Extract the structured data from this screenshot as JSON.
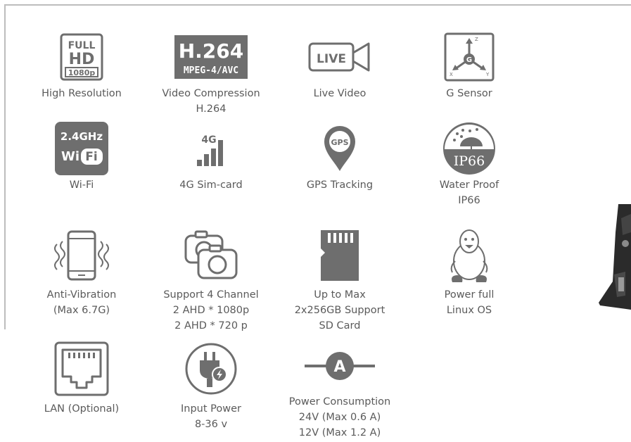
{
  "features": [
    {
      "icon": "full-hd-icon",
      "badge": [
        "FULL",
        "HD",
        "1080p"
      ],
      "lines": [
        "High Resolution"
      ]
    },
    {
      "icon": "h264-icon",
      "badge": [
        "H.264",
        "MPEG-4/AVC"
      ],
      "lines": [
        "Video Compression",
        "H.264"
      ]
    },
    {
      "icon": "live-video-icon",
      "badge": [
        "LIVE"
      ],
      "lines": [
        "Live Video"
      ]
    },
    {
      "icon": "g-sensor-icon",
      "badge": [
        "G",
        "Z",
        "X",
        "Y"
      ],
      "lines": [
        "G Sensor"
      ]
    },
    {
      "icon": "wifi-icon",
      "badge": [
        "2.4GHz",
        "Wi",
        "Fi"
      ],
      "lines": [
        "Wi-Fi"
      ]
    },
    {
      "icon": "4g-signal-icon",
      "badge": [
        "4G"
      ],
      "lines": [
        "4G Sim-card"
      ]
    },
    {
      "icon": "gps-pin-icon",
      "badge": [
        "GPS"
      ],
      "lines": [
        "GPS Tracking"
      ]
    },
    {
      "icon": "ip66-umbrella-icon",
      "badge": [
        "IP66"
      ],
      "lines": [
        "Water Proof",
        "IP66"
      ]
    },
    {
      "icon": "vibrating-phone-icon",
      "badge": [],
      "lines": [
        "Anti-Vibration",
        "(Max 6.7G)"
      ]
    },
    {
      "icon": "cameras-icon",
      "badge": [],
      "lines": [
        "Support 4 Channel",
        "2 AHD * 1080p",
        "2 AHD * 720 p"
      ]
    },
    {
      "icon": "sd-card-icon",
      "badge": [],
      "lines": [
        "Up to Max",
        "2x256GB Support",
        "SD Card"
      ]
    },
    {
      "icon": "linux-penguin-icon",
      "badge": [],
      "lines": [
        "Power full",
        "Linux OS"
      ]
    },
    {
      "icon": "lan-port-icon",
      "badge": [],
      "lines": [
        "LAN (Optional)"
      ]
    },
    {
      "icon": "power-plug-icon",
      "badge": [],
      "lines": [
        "Input Power",
        "8-36 v"
      ]
    },
    {
      "icon": "ammeter-icon",
      "badge": [
        "A"
      ],
      "lines": [
        "Power Consumption",
        "24V (Max 0.6 A)",
        "12V (Max 1.2 A)"
      ]
    }
  ],
  "colors": {
    "icon": "#6e6e6e",
    "text": "#5a5a5a",
    "frame": "#bdbdbd"
  }
}
